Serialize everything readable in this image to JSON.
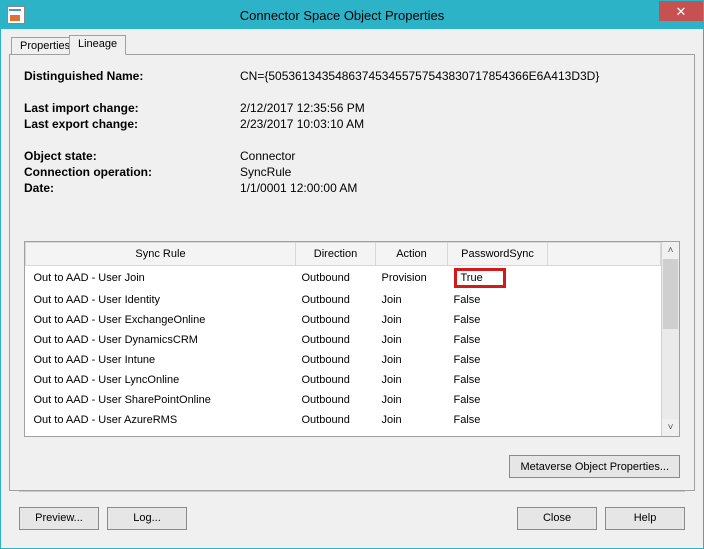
{
  "window": {
    "title": "Connector Space Object Properties"
  },
  "tabs": {
    "properties": "Properties",
    "lineage": "Lineage"
  },
  "details": {
    "dn_label": "Distinguished Name:",
    "dn_value": "CN={505361343548637453455757543830717854366E6A413D3D}",
    "last_import_label": "Last import change:",
    "last_import_value": "2/12/2017 12:35:56 PM",
    "last_export_label": "Last export change:",
    "last_export_value": "2/23/2017 10:03:10 AM",
    "obj_state_label": "Object state:",
    "obj_state_value": "Connector",
    "conn_op_label": "Connection operation:",
    "conn_op_value": "SyncRule",
    "date_label": "Date:",
    "date_value": "1/1/0001 12:00:00 AM"
  },
  "columns": {
    "sync_rule": "Sync Rule",
    "direction": "Direction",
    "action": "Action",
    "password_sync": "PasswordSync"
  },
  "rows": [
    {
      "rule": "Out to AAD - User Join",
      "direction": "Outbound",
      "action": "Provision",
      "pwsync": "True",
      "highlight": true
    },
    {
      "rule": "Out to AAD - User Identity",
      "direction": "Outbound",
      "action": "Join",
      "pwsync": "False",
      "highlight": false
    },
    {
      "rule": "Out to AAD - User ExchangeOnline",
      "direction": "Outbound",
      "action": "Join",
      "pwsync": "False",
      "highlight": false
    },
    {
      "rule": "Out to AAD - User DynamicsCRM",
      "direction": "Outbound",
      "action": "Join",
      "pwsync": "False",
      "highlight": false
    },
    {
      "rule": "Out to AAD - User Intune",
      "direction": "Outbound",
      "action": "Join",
      "pwsync": "False",
      "highlight": false
    },
    {
      "rule": "Out to AAD - User LyncOnline",
      "direction": "Outbound",
      "action": "Join",
      "pwsync": "False",
      "highlight": false
    },
    {
      "rule": "Out to AAD - User SharePointOnline",
      "direction": "Outbound",
      "action": "Join",
      "pwsync": "False",
      "highlight": false
    },
    {
      "rule": "Out to AAD - User AzureRMS",
      "direction": "Outbound",
      "action": "Join",
      "pwsync": "False",
      "highlight": false
    }
  ],
  "buttons": {
    "mv_obj_props": "Metaverse Object Properties...",
    "preview": "Preview...",
    "log": "Log...",
    "close": "Close",
    "help": "Help"
  },
  "icons": {
    "close_x": "✕",
    "up": "˄",
    "down": "˅"
  }
}
